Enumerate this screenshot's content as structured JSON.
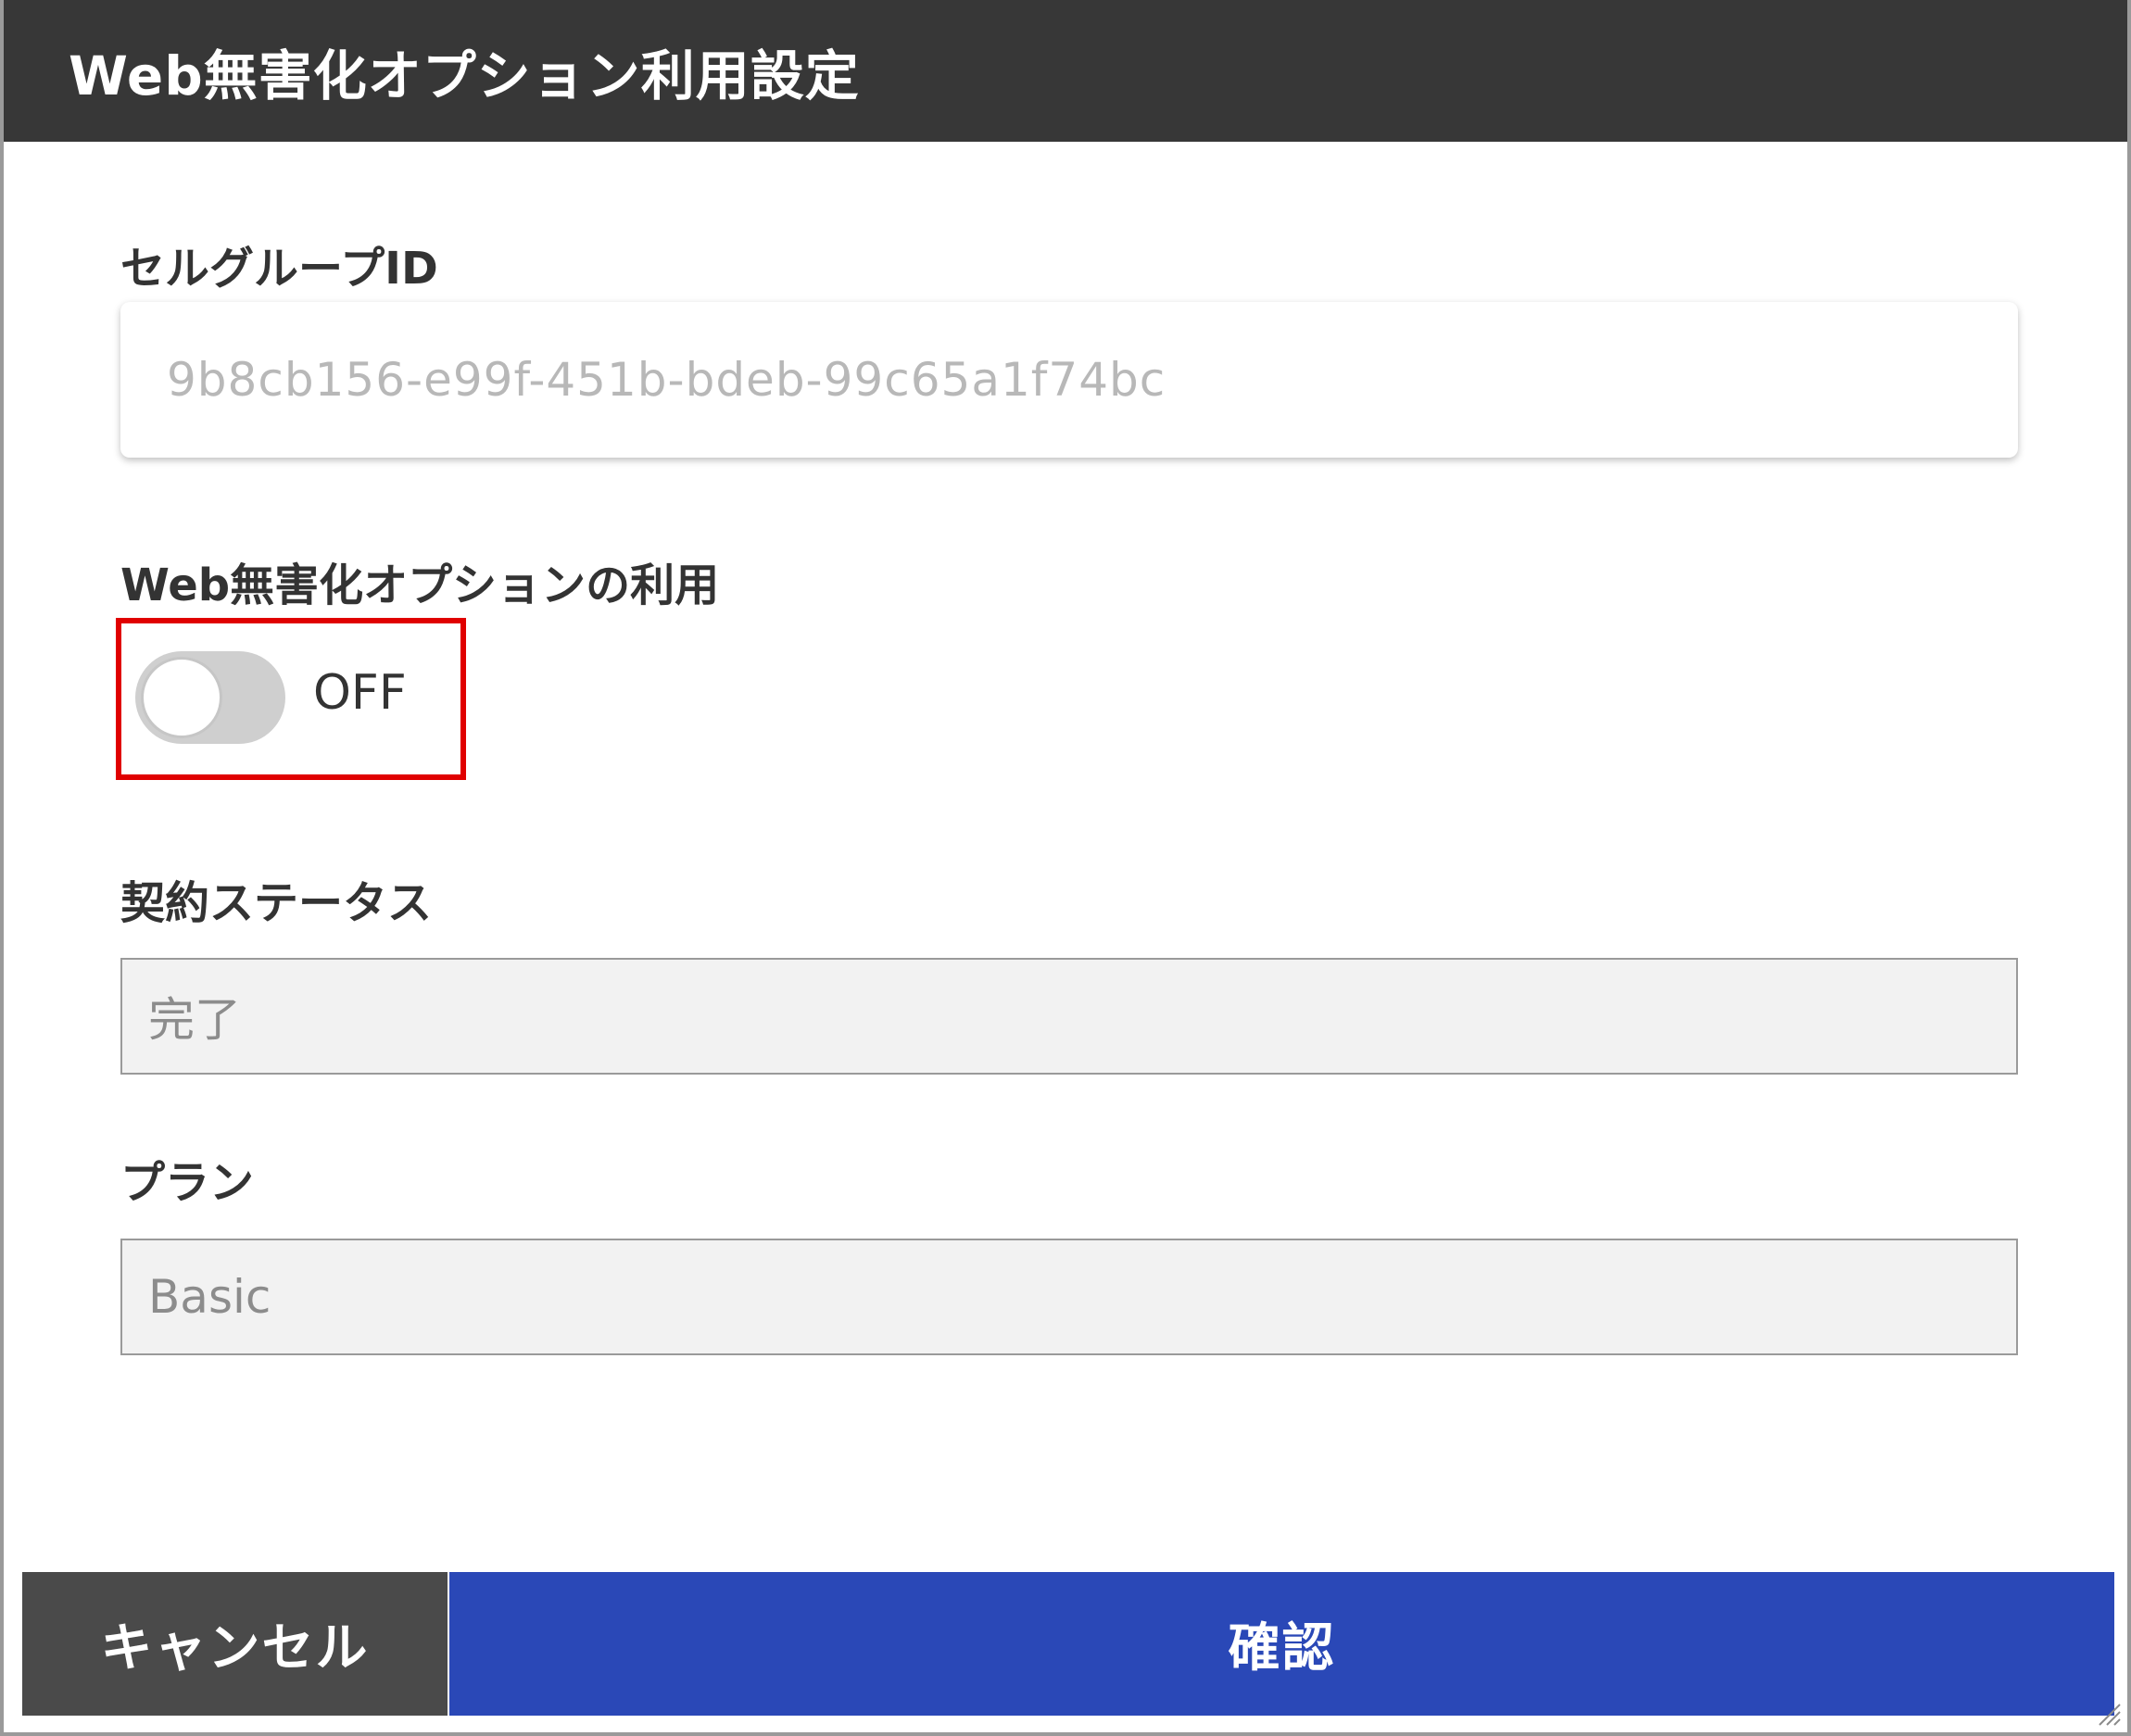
{
  "dialog": {
    "title": "Web無害化オプション利用設定"
  },
  "cell_group": {
    "label": "セルグループID",
    "value": "9b8cb156-e99f-451b-bdeb-99c65a1f74bc"
  },
  "web_option": {
    "label": "Web無害化オプションの利用",
    "toggle_state": "OFF",
    "toggle_on": false
  },
  "contract_status": {
    "label": "契約ステータス",
    "value": "完了"
  },
  "plan": {
    "label": "プラン",
    "value": "Basic"
  },
  "buttons": {
    "cancel_label": "キャンセル",
    "confirm_label": "確認"
  },
  "colors": {
    "titlebar": "#373737",
    "confirm": "#2a48b7",
    "cancel": "#4a4a4a",
    "highlight": "#e00000"
  }
}
